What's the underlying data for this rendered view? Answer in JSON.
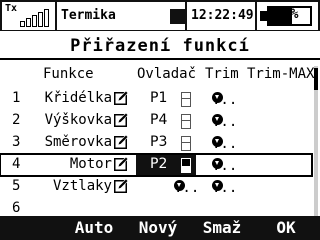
{
  "status": {
    "tx_label": "Tx",
    "signal_bars": 5,
    "model_name": "Termika",
    "time": "12:22:49",
    "battery_text": "57%",
    "battery_level": 0.57
  },
  "title": "Přiřazení funkcí",
  "columns": {
    "funkce": "Funkce",
    "ovladac": "Ovladač",
    "trim": "Trim",
    "trim_max": "Trim-MAX"
  },
  "rows": [
    {
      "num": "1",
      "name": "Křidélka",
      "channel": "P1",
      "trim": "...",
      "selected": false
    },
    {
      "num": "2",
      "name": "Výškovka",
      "channel": "P4",
      "trim": "...",
      "selected": false
    },
    {
      "num": "3",
      "name": "Směrovka",
      "channel": "P3",
      "trim": "...",
      "selected": false
    },
    {
      "num": "4",
      "name": "Motor",
      "channel": "P2",
      "trim": "...",
      "selected": true
    },
    {
      "num": "5",
      "name": "Vztlaky",
      "channel": "",
      "trim": "...",
      "trim2": "...",
      "selected": false
    },
    {
      "num": "6",
      "name": "",
      "channel": "",
      "trim": "",
      "selected": false
    }
  ],
  "softkeys": {
    "auto": "Auto",
    "novy": "Nový",
    "smaz": "Smaž",
    "ok": "OK"
  },
  "icons": {
    "edit": "pencil-in-box-icon",
    "switch": "switch-slot-icon",
    "arrow": "circle-down-arrow-icon"
  }
}
